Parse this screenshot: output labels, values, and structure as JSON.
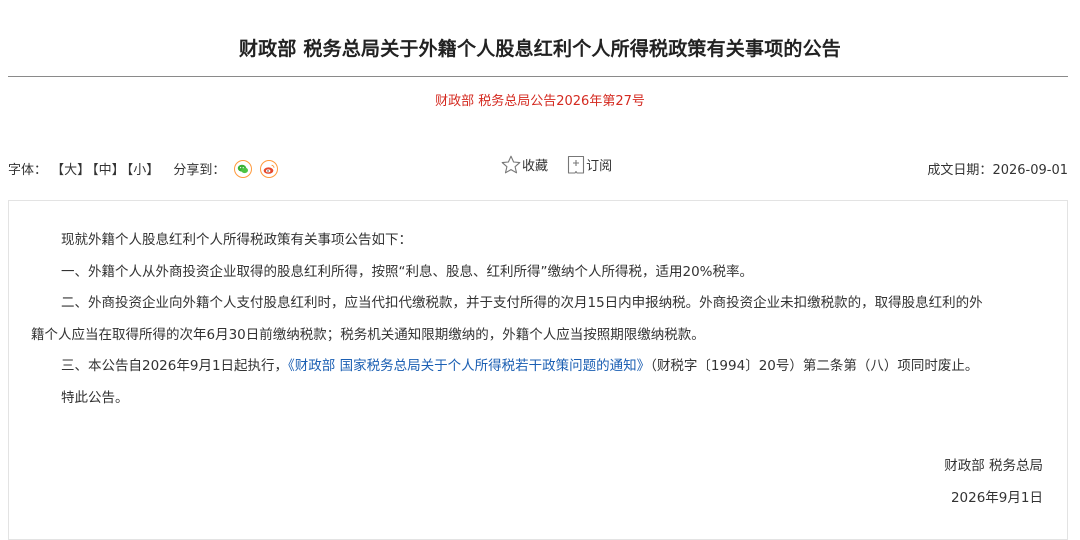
{
  "header": {
    "title": "财政部 税务总局关于外籍个人股息红利个人所得税政策有关事项的公告",
    "doc_number": "财政部 税务总局公告2026年第27号"
  },
  "toolbar": {
    "font_label": "字体：",
    "size_large": "【大】",
    "size_medium": "【中】",
    "size_small": "【小】",
    "share_label": "分享到：",
    "share_icons": [
      "wechat-icon",
      "weibo-icon"
    ],
    "favorite_label": "收藏",
    "subscribe_label": "订阅",
    "date_label": "成文日期：",
    "date_value": "2026-09-01"
  },
  "body": {
    "intro": "现就外籍个人股息红利个人所得税政策有关事项公告如下：",
    "item1": "一、外籍个人从外商投资企业取得的股息红利所得，按照“利息、股息、红利所得”缴纳个人所得税，适用20%税率。",
    "item2_line1": "二、外商投资企业向外籍个人支付股息红利时，应当代扣代缴税款，并于支付所得的次月15日内申报纳税。外商投资企业未扣缴税款的，取得股息红利的外",
    "item2_line2": "籍个人应当在取得所得的次年6月30日前缴纳税款；税务机关通知限期缴纳的，外籍个人应当按照期限缴纳税款。",
    "item3_prefix": "三、本公告自2026年9月1日起执行，",
    "item3_link": "《财政部 国家税务总局关于个人所得税若干政策问题的通知》",
    "item3_suffix": "（财税字〔1994〕20号）第二条第（八）项同时废止。",
    "closing": "特此公告。",
    "signature_org": "财政部 税务总局",
    "signature_date": "2026年9月1日"
  },
  "colors": {
    "doc_number": "#d42a20",
    "link": "#1b5fb3",
    "share_border": "#ff9a3c",
    "wechat": "#3cb035",
    "weibo": "#e6492d"
  }
}
